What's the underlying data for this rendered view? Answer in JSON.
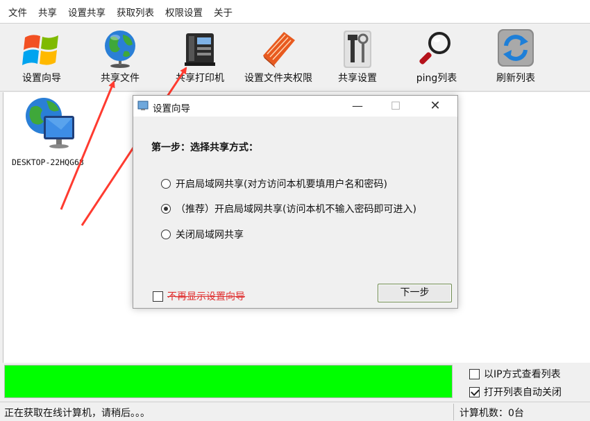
{
  "menu": [
    "文件",
    "共享",
    "设置共享",
    "获取列表",
    "权限设置",
    "关于"
  ],
  "toolbar": [
    {
      "label": "设置向导",
      "icon": "windows-logo-icon"
    },
    {
      "label": "共享文件",
      "icon": "globe-icon"
    },
    {
      "label": "共享打印机",
      "icon": "printer-icon"
    },
    {
      "label": "设置文件夹权限",
      "icon": "folder-book-icon"
    },
    {
      "label": "共享设置",
      "icon": "tools-icon"
    },
    {
      "label": "ping列表",
      "icon": "magnifier-icon"
    },
    {
      "label": "刷新列表",
      "icon": "refresh-icon"
    }
  ],
  "computers": [
    {
      "name": "DESKTOP-22HQG68",
      "icon": "computer-globe-icon"
    }
  ],
  "dialog": {
    "title": "设置向导",
    "step_label": "第一步：选择共享方式：",
    "options": [
      {
        "label": "开启局域网共享(对方访问本机要填用户名和密码)",
        "selected": false
      },
      {
        "label": "（推荐）开启局域网共享(访问本机不输入密码即可进入)",
        "selected": true
      },
      {
        "label": "关闭局域网共享",
        "selected": false
      }
    ],
    "dont_show_label": "不再显示设置向导",
    "dont_show_checked": false,
    "next_button": "下一步"
  },
  "progress": {
    "value": 1.0,
    "color": "#00ff00"
  },
  "options_panel": [
    {
      "label": "以IP方式查看列表",
      "checked": false
    },
    {
      "label": "打开列表自动关闭",
      "checked": true
    }
  ],
  "status": {
    "message": "正在获取在线计算机，请稍后。。。",
    "count_label": "计算机数：0台"
  },
  "colors": {
    "arrow": "#ff3b30",
    "accent_border": "#6d8a4e"
  }
}
